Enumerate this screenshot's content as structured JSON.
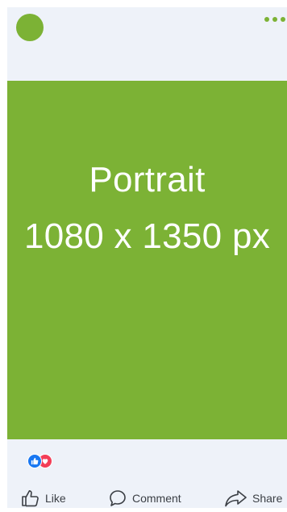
{
  "post": {
    "image": {
      "line1": "Portrait",
      "line2": "1080 x 1350 px",
      "background": "#7cb235"
    },
    "reactions": [
      "like",
      "love"
    ],
    "actions": [
      {
        "icon": "thumbs-up-icon",
        "label": "Like"
      },
      {
        "icon": "comment-icon",
        "label": "Comment"
      },
      {
        "icon": "share-icon",
        "label": "Share"
      }
    ]
  },
  "colors": {
    "accent": "#7cb235",
    "background": "#eef2f9",
    "like": "#1877f2",
    "love": "#f33e58",
    "text": "#3b3f45"
  }
}
